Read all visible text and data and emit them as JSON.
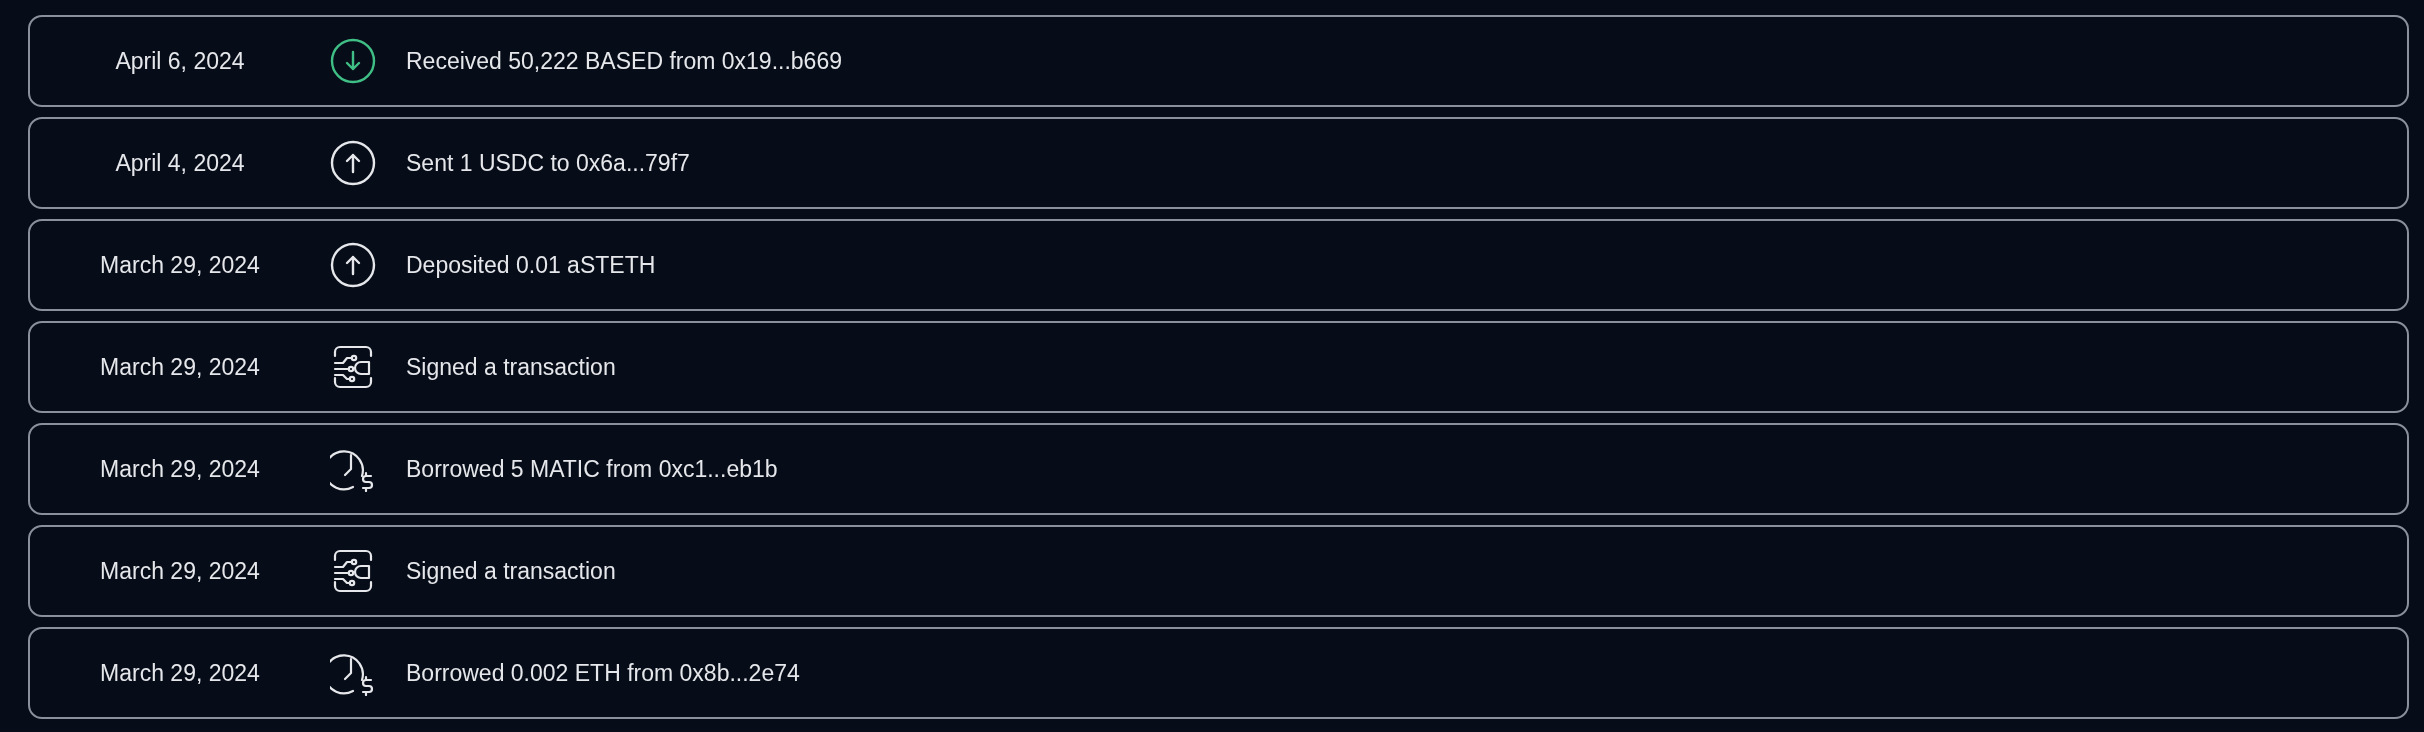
{
  "activity": [
    {
      "date": "April 6, 2024",
      "kind": "received",
      "description": "Received 50,222 BASED from 0x19...b669"
    },
    {
      "date": "April 4, 2024",
      "kind": "sent",
      "description": "Sent 1 USDC to 0x6a...79f7"
    },
    {
      "date": "March 29, 2024",
      "kind": "sent",
      "description": "Deposited 0.01 aSTETH"
    },
    {
      "date": "March 29, 2024",
      "kind": "signed",
      "description": "Signed a transaction"
    },
    {
      "date": "March 29, 2024",
      "kind": "borrowed",
      "description": "Borrowed 5 MATIC from 0xc1...eb1b"
    },
    {
      "date": "March 29, 2024",
      "kind": "signed",
      "description": "Signed a transaction"
    },
    {
      "date": "March 29, 2024",
      "kind": "borrowed",
      "description": "Borrowed 0.002 ETH from 0x8b...2e74"
    }
  ]
}
